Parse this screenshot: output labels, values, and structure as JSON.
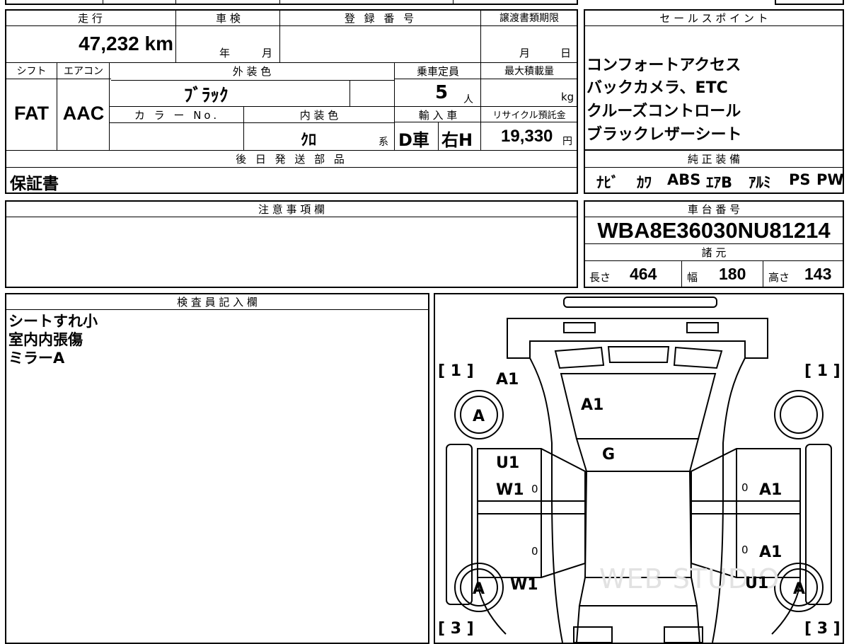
{
  "top_strip": {
    "label": "登録番号"
  },
  "main": {
    "headers": {
      "mileage": "走 行",
      "inspection": "車 検",
      "reg_number": "登 録 番 号",
      "transfer_deadline": "譲渡書類期限",
      "shift": "シフト",
      "aircon": "エアコン",
      "exterior_color": "外 装 色",
      "capacity": "乗車定員",
      "max_load": "最大積載量",
      "color_no": "カ ラ ー No.",
      "interior_color": "内 装 色",
      "import": "輸 入 車",
      "recycle": "リサイクル預託金",
      "later_parts": "後 日 発 送 部 品"
    },
    "mileage_value": "47,232 km",
    "inspection_year": "年",
    "inspection_month": "月",
    "deadline_month": "月",
    "deadline_day": "日",
    "shift_value": "FAT",
    "aircon_value": "AAC",
    "exterior_color_value": "ﾌﾞﾗｯｸ",
    "capacity_value": "5",
    "capacity_unit": "人",
    "load_unit": "kg",
    "interior_color_value": "ｸﾛ",
    "interior_suffix": "系",
    "import_type": "D車",
    "handle": "右H",
    "recycle_value": "19,330",
    "recycle_unit": "円",
    "later_parts_value": "保証書"
  },
  "sales_points": {
    "header": "セ ー ル ス ポ イ ン ト",
    "items": [
      "コンフォートアクセス",
      "バックカメラ、ETC",
      "クルーズコントロール",
      "ブラックレザーシート"
    ]
  },
  "standard_equipment": {
    "header": "純 正 装 備",
    "items": [
      "ﾅﾋﾞ",
      "ｶﾜ",
      "ABS",
      "ｴｱB",
      "ｱﾙﾐ",
      "PS",
      "PW"
    ]
  },
  "notes": {
    "header": "注 意 事 項 欄"
  },
  "chassis": {
    "header": "車 台 番 号",
    "value": "WBA8E36030NU81214"
  },
  "specs": {
    "header": "諸 元",
    "length_label": "長さ",
    "length": "464",
    "width_label": "幅",
    "width": "180",
    "height_label": "高さ",
    "height": "143"
  },
  "inspector": {
    "header": "検 査 員 記 入 欄",
    "lines": [
      "シートすれ小",
      "室内内張傷",
      "ミラーA"
    ]
  },
  "diagram": {
    "bracket_front_left": "[ 1 ]",
    "bracket_front_right": "[ 1 ]",
    "bracket_rear_left": "[ 3 ]",
    "bracket_rear_right": "[ 3 ]",
    "front_left_fender": "A1",
    "hood": "A1",
    "windshield": "G",
    "front_left_wheel": "A",
    "rear_left_wheel": "A",
    "rear_right_wheel": "A",
    "front_left_door_1": "U1",
    "front_left_door_2": "W1",
    "rear_left_quarter": "W1",
    "front_right_door": "A1",
    "rear_right_door": "A1",
    "rear_right_quarter": "U1",
    "zero": "0",
    "watermark": "WEB STUDIO"
  }
}
